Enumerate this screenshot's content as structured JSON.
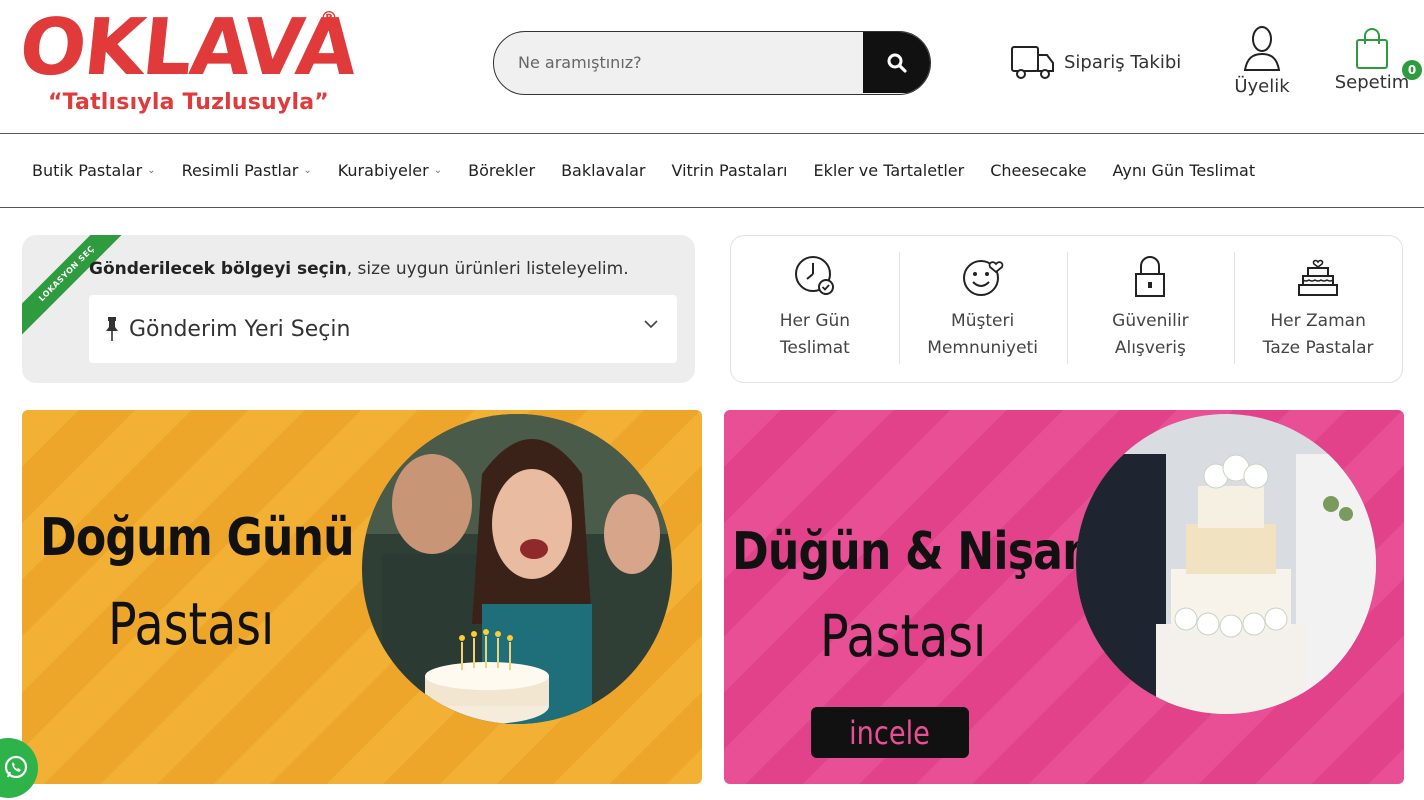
{
  "brand": {
    "logo_text": "OKLAVA",
    "registered_mark": "®",
    "tagline": "“Tatlısıyla Tuzlusuyla”"
  },
  "search": {
    "placeholder": "Ne aramıştınız?",
    "icon": "search-icon"
  },
  "header_actions": {
    "order_tracking": {
      "label": "Sipariş Takibi",
      "icon": "truck-icon"
    },
    "membership": {
      "label": "Üyelik",
      "icon": "user-icon"
    },
    "cart": {
      "label": "Sepetim",
      "icon": "shopping-bag-icon",
      "count": "0"
    }
  },
  "nav": {
    "items": [
      {
        "label": "Butik Pastalar",
        "dropdown": true
      },
      {
        "label": "Resimli Pastlar",
        "dropdown": true
      },
      {
        "label": "Kurabiyeler",
        "dropdown": true
      },
      {
        "label": "Börekler",
        "dropdown": false
      },
      {
        "label": "Baklavalar",
        "dropdown": false
      },
      {
        "label": "Vitrin Pastaları",
        "dropdown": false
      },
      {
        "label": "Ekler ve Tartaletler",
        "dropdown": false
      },
      {
        "label": "Cheesecake",
        "dropdown": false
      },
      {
        "label": "Aynı Gün Teslimat",
        "dropdown": false
      }
    ]
  },
  "location": {
    "ribbon": "LOKASYON SEÇ",
    "prompt_bold": "Gönderilecek bölgeyi seçin",
    "prompt_rest": ", size uygun ürünleri listeleyelim.",
    "select_label": "Gönderim Yeri Seçin"
  },
  "features": [
    {
      "line1": "Her Gün",
      "line2": "Teslimat",
      "icon": "clock-check-icon"
    },
    {
      "line1": "Müşteri",
      "line2": "Memnuniyeti",
      "icon": "smiley-heart-icon"
    },
    {
      "line1": "Güvenilir",
      "line2": "Alışveriş",
      "icon": "lock-icon"
    },
    {
      "line1": "Her Zaman",
      "line2": "Taze Pastalar",
      "icon": "cake-icon"
    }
  ],
  "banners": [
    {
      "title": "Doğum Günü",
      "subtitle": "Pastası",
      "color": "#f2b034"
    },
    {
      "title": "Düğün & Nişan",
      "subtitle": "Pastası",
      "button": "incele",
      "color": "#e84f94"
    }
  ],
  "colors": {
    "brand_red": "#e03a3a",
    "accent_green": "#2e9b3e",
    "whatsapp_green": "#2eb24a"
  },
  "floating": {
    "whatsapp_icon": "whatsapp-icon"
  }
}
